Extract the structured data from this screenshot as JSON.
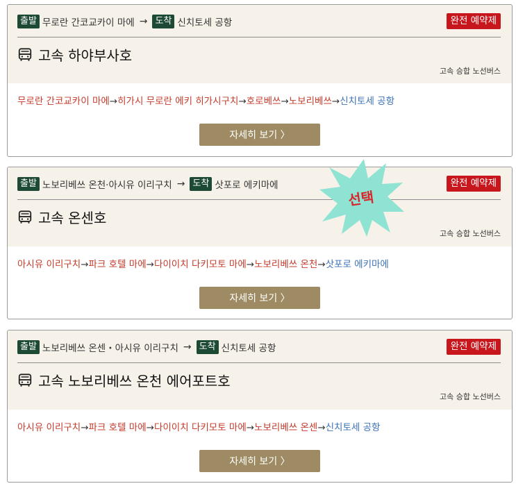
{
  "routes": [
    {
      "depart_tag": "출발",
      "depart": "무로란 간코교카이 마에",
      "arrive_tag": "도착",
      "arrive": "신치토세 공항",
      "status": "완전 예약제",
      "name": "고속 하야부사호",
      "type": "고속 승합 노선버스",
      "stops": [
        "무로란 간코교카이 마에",
        "히가시 무로란 에키 히가시구치",
        "호로베쓰",
        "노보리베쓰",
        "신치토세 공항"
      ],
      "sep": "→",
      "button": "자세히 보기 〉"
    },
    {
      "depart_tag": "출발",
      "depart": "노보리베쓰 온천·아시유 이리구치",
      "arrive_tag": "도착",
      "arrive": "삿포로 에키마에",
      "status": "완전 예약제",
      "name": "고속 온센호",
      "type": "고속 승합 노선버스",
      "stops": [
        "아시유 이리구치",
        "파크 호텔 마에",
        "다이이치 다키모토 마에",
        "노보리베쓰 온천",
        "삿포로 에키마에"
      ],
      "sep": "→",
      "button": "자세히 보기 〉"
    },
    {
      "depart_tag": "출발",
      "depart": "노보리베쓰 온센・아시유 이리구치",
      "arrive_tag": "도착",
      "arrive": "신치토세 공항",
      "status": "완전 예약제",
      "name": "고속 노보리베쓰 온천 에어포트호",
      "type": "고속 승합 노선버스",
      "stops": [
        "아시유 이리구치",
        "파크 호텔 마에",
        "다이이치 다키모토 마에",
        "노보리베쓰 온센",
        "신치토세 공항"
      ],
      "sep": "→",
      "button": "자세히 보기 〉"
    }
  ],
  "highlight": {
    "label": "선택",
    "color": "#8fe3d2",
    "text_color": "#d8262b"
  },
  "icon": "bus-icon",
  "colors": {
    "tag_bg": "#1d4a34",
    "status_bg": "#c8161d",
    "button_bg": "#9e8b63",
    "stop": "#c43b2b",
    "final_stop": "#3d73b8"
  }
}
